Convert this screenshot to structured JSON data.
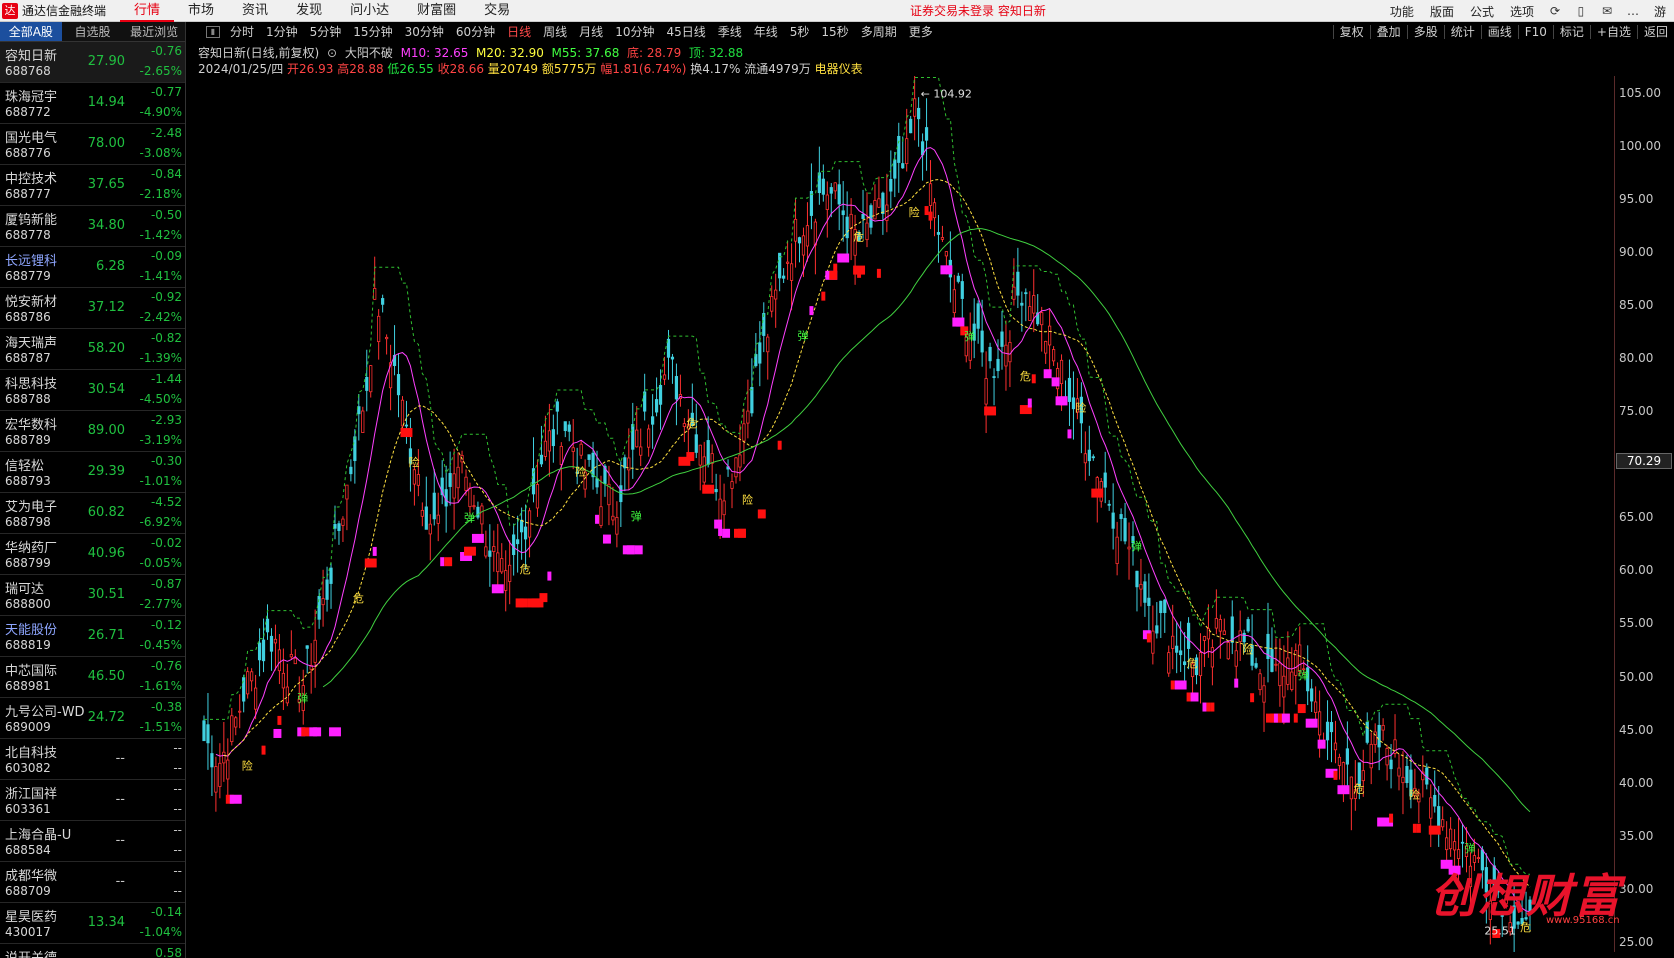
{
  "app": {
    "logo": "达",
    "title": "通达信金融终端",
    "menu": [
      "行情",
      "市场",
      "资讯",
      "发现",
      "问小达",
      "财富圈",
      "交易"
    ],
    "active_menu": "行情",
    "login_warning": "证券交易未登录   容知日新",
    "right_menu": [
      "功能",
      "版面",
      "公式",
      "选项"
    ],
    "right_icons": [
      "refresh-icon",
      "phone-icon",
      "mail-icon",
      "more-icon"
    ],
    "right_edge_label": "游"
  },
  "sidebar": {
    "tabs": [
      "全部A股",
      "自选股",
      "最近浏览"
    ],
    "active_tab": "全部A股",
    "stocks": [
      {
        "name": "容知日新",
        "code": "688768",
        "price": "27.90",
        "chg": "-0.76",
        "pct": "-2.65%",
        "blue": false
      },
      {
        "name": "珠海冠宇",
        "code": "688772",
        "price": "14.94",
        "chg": "-0.77",
        "pct": "-4.90%",
        "blue": false
      },
      {
        "name": "国光电气",
        "code": "688776",
        "price": "78.00",
        "chg": "-2.48",
        "pct": "-3.08%",
        "blue": false
      },
      {
        "name": "中控技术",
        "code": "688777",
        "price": "37.65",
        "chg": "-0.84",
        "pct": "-2.18%",
        "blue": false
      },
      {
        "name": "厦钨新能",
        "code": "688778",
        "price": "34.80",
        "chg": "-0.50",
        "pct": "-1.42%",
        "blue": false
      },
      {
        "name": "长远锂科",
        "code": "688779",
        "price": "6.28",
        "chg": "-0.09",
        "pct": "-1.41%",
        "blue": true
      },
      {
        "name": "悦安新材",
        "code": "688786",
        "price": "37.12",
        "chg": "-0.92",
        "pct": "-2.42%",
        "blue": false
      },
      {
        "name": "海天瑞声",
        "code": "688787",
        "price": "58.20",
        "chg": "-0.82",
        "pct": "-1.39%",
        "blue": false
      },
      {
        "name": "科思科技",
        "code": "688788",
        "price": "30.54",
        "chg": "-1.44",
        "pct": "-4.50%",
        "blue": false
      },
      {
        "name": "宏华数科",
        "code": "688789",
        "price": "89.00",
        "chg": "-2.93",
        "pct": "-3.19%",
        "blue": false
      },
      {
        "name": "信轻松",
        "code": "688793",
        "price": "29.39",
        "chg": "-0.30",
        "pct": "-1.01%",
        "blue": false
      },
      {
        "name": "艾为电子",
        "code": "688798",
        "price": "60.82",
        "chg": "-4.52",
        "pct": "-6.92%",
        "blue": false
      },
      {
        "name": "华纳药厂",
        "code": "688799",
        "price": "40.96",
        "chg": "-0.02",
        "pct": "-0.05%",
        "blue": false
      },
      {
        "name": "瑞可达",
        "code": "688800",
        "price": "30.51",
        "chg": "-0.87",
        "pct": "-2.77%",
        "blue": false
      },
      {
        "name": "天能股份",
        "code": "688819",
        "price": "26.71",
        "chg": "-0.12",
        "pct": "-0.45%",
        "blue": true
      },
      {
        "name": "中芯国际",
        "code": "688981",
        "price": "46.50",
        "chg": "-0.76",
        "pct": "-1.61%",
        "blue": false
      },
      {
        "name": "九号公司-WD",
        "code": "689009",
        "price": "24.72",
        "chg": "-0.38",
        "pct": "-1.51%",
        "blue": false
      },
      {
        "name": "北自科技",
        "code": "603082",
        "price": "--",
        "chg": "--",
        "pct": "--",
        "blue": false
      },
      {
        "name": "浙江国祥",
        "code": "603361",
        "price": "--",
        "chg": "--",
        "pct": "--",
        "blue": false
      },
      {
        "name": "上海合晶-U",
        "code": "688584",
        "price": "--",
        "chg": "--",
        "pct": "--",
        "blue": false
      },
      {
        "name": "成都华微",
        "code": "688709",
        "price": "--",
        "chg": "--",
        "pct": "--",
        "blue": false
      },
      {
        "name": "星昊医药",
        "code": "430017",
        "price": "13.34",
        "chg": "-0.14",
        "pct": "-1.04%",
        "blue": false
      },
      {
        "name": "说开关德",
        "code": "",
        "price": "",
        "chg": "0.58",
        "pct": "",
        "blue": false
      }
    ]
  },
  "periods": [
    "分时",
    "1分钟",
    "5分钟",
    "15分钟",
    "30分钟",
    "60分钟",
    "日线",
    "周线",
    "月线",
    "10分钟",
    "45日线",
    "季线",
    "年线",
    "5秒",
    "15秒",
    "多周期",
    "更多"
  ],
  "active_period": "日线",
  "tools": [
    "复权",
    "叠加",
    "多股",
    "统计",
    "画线",
    "F10",
    "标记",
    "+自选",
    "返回"
  ],
  "header": {
    "stock_title": "容知日新(日线,前复权)",
    "indicator_name": "大阳不破",
    "ma10": "M10: 32.65",
    "ma20": "M20: 32.90",
    "ma55": "M55: 37.68",
    "bottom": "底: 28.79",
    "top": "顶: 32.88",
    "date": "2024/01/25/四",
    "open": "开26.93",
    "high": "高28.88",
    "low": "低26.55",
    "close": "收28.66",
    "volume": "量20749",
    "amount": "额5775万",
    "amplitude": "幅1.81(6.74%)",
    "turnover": "换4.17%",
    "float_shares": "流通4979万",
    "industry": "电器仪表"
  },
  "chart_data": {
    "type": "candlestick",
    "title": "容知日新(日线,前复权)",
    "y_ticks": [
      "105.00",
      "100.00",
      "95.00",
      "90.00",
      "85.00",
      "80.00",
      "75.00",
      "70.00",
      "65.00",
      "60.00",
      "55.00",
      "50.00",
      "45.00",
      "40.00",
      "35.00",
      "30.00",
      "25.00"
    ],
    "ylim": [
      25,
      106
    ],
    "cursor_value": "70.29",
    "max_label": "104.92",
    "min_label": "25.51",
    "close_path": [
      44,
      43,
      42,
      44,
      46,
      49,
      50,
      52,
      54,
      53,
      51,
      50,
      49,
      52,
      55,
      58,
      62,
      66,
      70,
      74,
      78,
      86,
      83,
      80,
      76,
      72,
      70,
      66,
      64,
      65,
      68,
      70,
      69,
      67,
      65,
      62,
      60,
      58,
      61,
      64,
      67,
      70,
      72,
      73,
      74,
      72,
      70,
      69,
      68,
      67,
      66,
      68,
      70,
      72,
      74,
      76,
      78,
      79,
      77,
      75,
      73,
      72,
      70,
      68,
      69,
      71,
      74,
      77,
      80,
      83,
      86,
      89,
      91,
      93,
      94,
      95,
      96,
      95,
      94,
      92,
      91,
      92,
      93,
      94,
      95,
      97,
      99,
      104,
      100,
      95,
      91,
      88,
      86,
      84,
      82,
      80,
      79,
      80,
      82,
      85,
      87,
      86,
      84,
      82,
      80,
      78,
      76,
      74,
      72,
      70,
      68,
      66,
      64,
      62,
      60,
      58,
      56,
      55,
      54,
      53,
      52,
      51,
      52,
      53,
      54,
      55,
      54,
      53,
      52,
      51,
      50,
      50,
      51,
      52,
      51,
      49,
      47,
      45,
      43,
      42,
      41,
      41,
      42,
      43,
      44,
      43,
      42,
      41,
      40,
      39,
      38,
      37,
      36,
      35,
      34,
      33,
      32,
      31,
      30,
      29,
      28,
      27,
      26
    ],
    "signal_labels": [
      "弹",
      "险",
      "危"
    ]
  },
  "watermark": {
    "text": "创想财富",
    "sub": "www.95168.cn"
  }
}
